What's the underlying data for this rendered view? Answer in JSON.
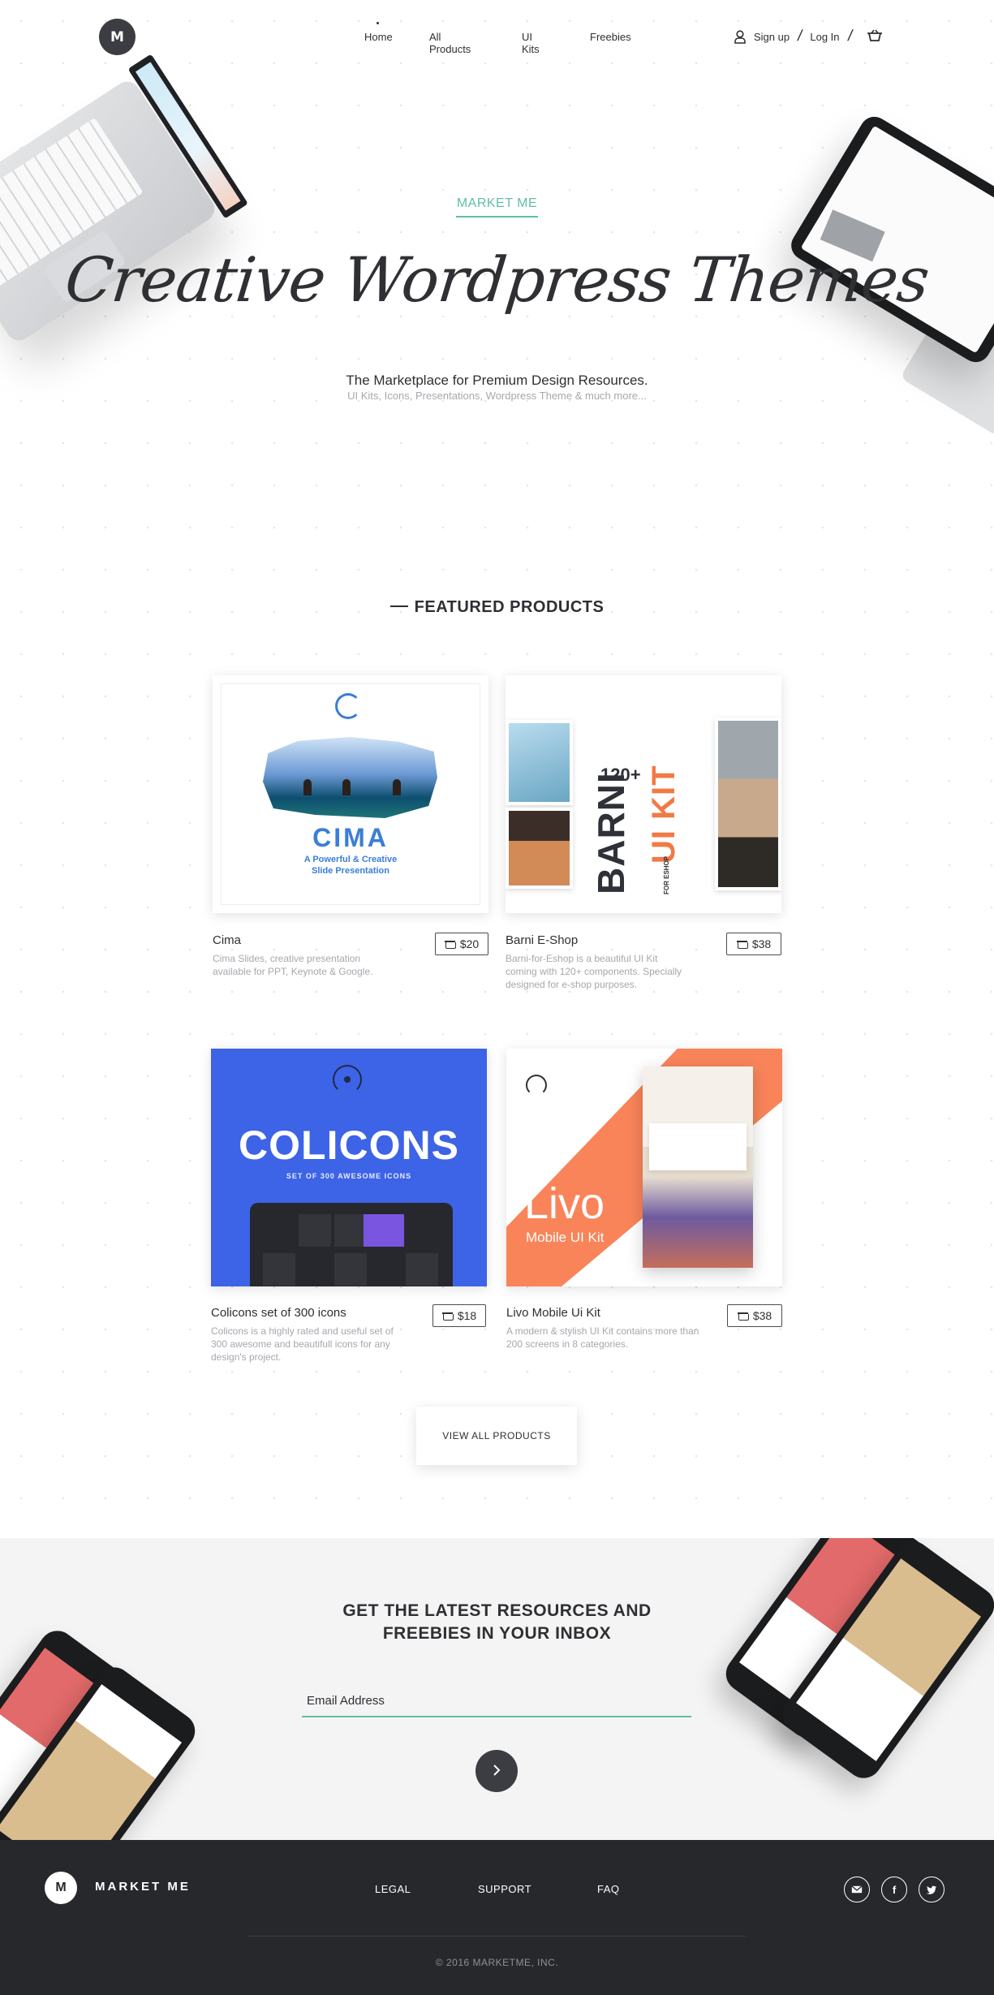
{
  "header": {
    "logo_letter": "M",
    "nav": [
      "Home",
      "All Products",
      "UI Kits",
      "Freebies"
    ],
    "signup_label": "Sign up",
    "login_label": "Log In"
  },
  "hero": {
    "eyebrow": "MARKET ME",
    "title": "Creative Wordpress Themes",
    "subtitle": "The Marketplace for Premium Design Resources.",
    "tagline": "UI Kits, Icons, Presentations, Wordpress Theme & much more..."
  },
  "featured": {
    "title": "FEATURED PRODUCTS",
    "products": [
      {
        "name": "Cima",
        "price": "$20",
        "description": "Cima Slides, creative presentation available for PPT, Keynote & Google.",
        "art_title": "CIMA",
        "art_tagline": "A Powerful & Creative Slide Presentation"
      },
      {
        "name": "Barni E-Shop",
        "price": "$38",
        "description": "Barni-for-Eshop is a beautiful UI Kit coming with 120+ components. Specially designed for e-shop purposes.",
        "art_title": "BARNI",
        "art_kit": "UI KIT",
        "art_count": "120+",
        "art_small": "FOR ESHOP"
      },
      {
        "name": "Colicons set of 300 icons",
        "price": "$18",
        "description": "Colicons is a highly rated and useful set of 300 awesome and beautifull icons for any design's project.",
        "art_title": "COLICONS",
        "art_sub": "SET OF 300 AWESOME ICONS"
      },
      {
        "name": "Livo Mobile Ui Kit",
        "price": "$38",
        "description": "A modern & stylish UI Kit contains more than 200 screens in 8 categories.",
        "art_title": "Livo",
        "art_sub": "Mobile UI Kit"
      }
    ],
    "view_all_label": "VIEW ALL PRODUCTS"
  },
  "newsletter": {
    "title_line1": "GET THE LATEST RESOURCES AND",
    "title_line2": "FREEBIES IN YOUR INBOX",
    "email_label": "Email Address",
    "submit_icon": "chevron-right-icon"
  },
  "footer": {
    "logo_letter": "M",
    "brand": "MARKET ME",
    "links": [
      "LEGAL",
      "SUPPORT",
      "FAQ"
    ],
    "social": [
      "mail-icon",
      "facebook-icon",
      "twitter-icon"
    ],
    "copyright": "© 2016 MARKETME, INC."
  },
  "colors": {
    "accent": "#5fbfa7",
    "dark": "#3b3d42",
    "footer_bg": "#26282c",
    "colicons_blue": "#3d63e6",
    "livo_orange": "#f9845a",
    "cima_blue": "#3a7ed8"
  }
}
